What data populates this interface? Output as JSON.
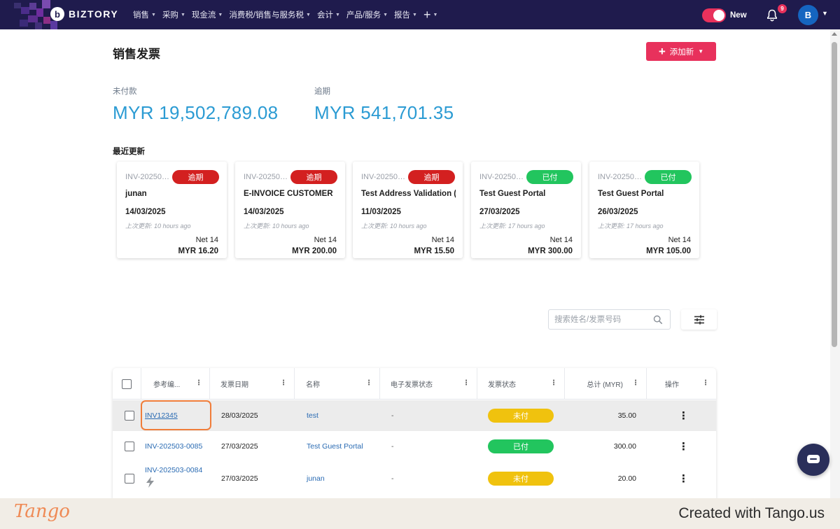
{
  "nav": {
    "brand": "BIZTORY",
    "items": [
      "销售",
      "采购",
      "现金流",
      "消费税/销售与服务税",
      "会计",
      "产品/服务",
      "报告"
    ],
    "plus": "+",
    "toggle_label": "New",
    "notifications_count": "9",
    "avatar_initial": "B",
    "colors": {
      "bar": "#1f1b4d",
      "accent": "#e8315c"
    }
  },
  "page": {
    "title": "销售发票",
    "add_button": "添加新",
    "stats": [
      {
        "label": "未付款",
        "value": "MYR 19,502,789.08"
      },
      {
        "label": "逾期",
        "value": "MYR 541,701.35"
      }
    ],
    "recent_title": "最近更新"
  },
  "recent_cards": [
    {
      "number": "INV-202503...",
      "status": "逾期",
      "status_color": "red",
      "customer": "junan",
      "date": "14/03/2025",
      "updated": "上次更新: 10 hours ago",
      "terms": "Net 14",
      "amount": "MYR 16.20"
    },
    {
      "number": "INV-202503...",
      "status": "逾期",
      "status_color": "red",
      "customer": "E-INVOICE CUSTOMER",
      "date": "14/03/2025",
      "updated": "上次更新: 10 hours ago",
      "terms": "Net 14",
      "amount": "MYR 200.00"
    },
    {
      "number": "INV-202503...",
      "status": "逾期",
      "status_color": "red",
      "customer": "Test Address Validation (...",
      "date": "11/03/2025",
      "updated": "上次更新: 10 hours ago",
      "terms": "Net 14",
      "amount": "MYR 15.50"
    },
    {
      "number": "INV-202503...",
      "status": "已付",
      "status_color": "green",
      "customer": "Test Guest Portal",
      "date": "27/03/2025",
      "updated": "上次更新: 17 hours ago",
      "terms": "Net 14",
      "amount": "MYR 300.00"
    },
    {
      "number": "INV-202503...",
      "status": "已付",
      "status_color": "green",
      "customer": "Test Guest Portal",
      "date": "26/03/2025",
      "updated": "上次更新: 17 hours ago",
      "terms": "Net 14",
      "amount": "MYR 105.00"
    }
  ],
  "search": {
    "placeholder": "搜索姓名/发票号码"
  },
  "table": {
    "headers": [
      "参考编...",
      "发票日期",
      "名称",
      "电子发票状态",
      "发票状态",
      "总计 (MYR)",
      "操作"
    ],
    "rows": [
      {
        "ref": "INV12345",
        "date": "28/03/2025",
        "name": "test",
        "einvoice": "-",
        "status": "未付",
        "status_color": "yellow",
        "total": "35.00"
      },
      {
        "ref": "INV-202503-0085",
        "date": "27/03/2025",
        "name": "Test Guest Portal",
        "einvoice": "-",
        "status": "已付",
        "status_color": "green",
        "total": "300.00"
      },
      {
        "ref": "INV-202503-0084",
        "date": "27/03/2025",
        "name": "junan",
        "einvoice": "-",
        "status": "未付",
        "status_color": "yellow",
        "total": "20.00"
      }
    ]
  },
  "footer": {
    "logo": "Tango",
    "created": "Created with Tango.us"
  }
}
